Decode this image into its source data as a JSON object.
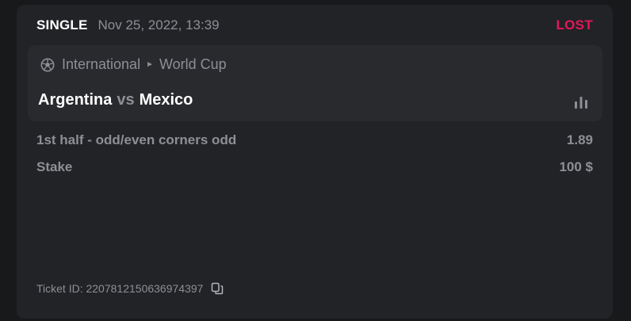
{
  "bet": {
    "type": "SINGLE",
    "date": "Nov 25, 2022, 13:39",
    "status": "LOST",
    "status_color": "#e5175a"
  },
  "event": {
    "sport_icon": "soccer-ball-icon",
    "region": "International",
    "league": "World Cup",
    "home_team": "Argentina",
    "vs": "vs",
    "away_team": "Mexico",
    "stats_icon": "bar-chart-icon"
  },
  "selection": {
    "market": "1st half - odd/even corners odd",
    "odds": "1.89",
    "stake_label": "Stake",
    "stake_value": "100 $"
  },
  "ticket": {
    "label": "Ticket ID: 2207812150636974397",
    "copy_icon": "copy-icon"
  }
}
